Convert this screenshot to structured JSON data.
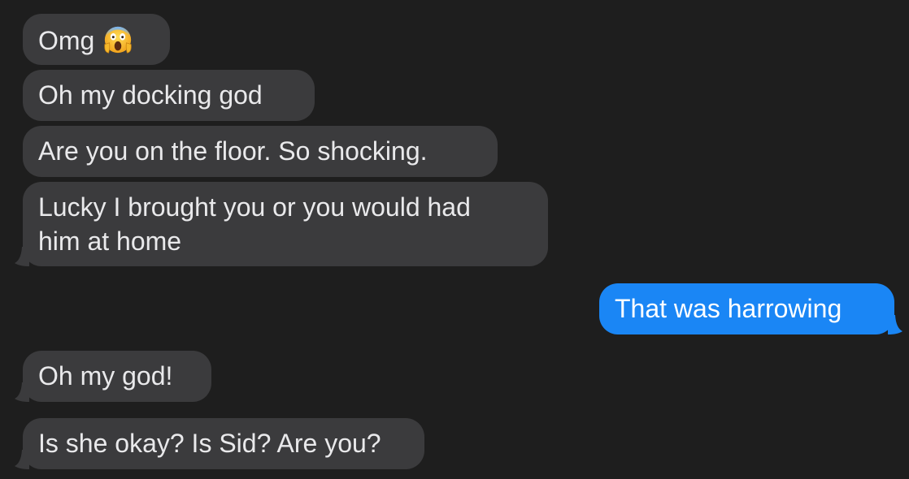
{
  "conversation": {
    "messages": [
      {
        "text": "Omg",
        "emoji": "screaming-in-fear-emoji",
        "direction": "incoming"
      },
      {
        "text": "Oh my docking god",
        "direction": "incoming"
      },
      {
        "text": "Are you on the floor. So shocking.",
        "direction": "incoming"
      },
      {
        "line1": "Lucky I brought you or you would had",
        "line2": "him at home",
        "direction": "incoming"
      },
      {
        "text": "That was harrowing",
        "direction": "outgoing"
      },
      {
        "text": "Oh my god!",
        "direction": "incoming"
      },
      {
        "text": "Is she okay? Is Sid? Are you?",
        "direction": "incoming"
      }
    ]
  },
  "colors": {
    "background": "#1e1e1e",
    "incoming_bubble": "#3b3b3d",
    "outgoing_bubble": "#1a86f5",
    "incoming_text": "#e9e9eb",
    "outgoing_text": "#ffffff"
  }
}
